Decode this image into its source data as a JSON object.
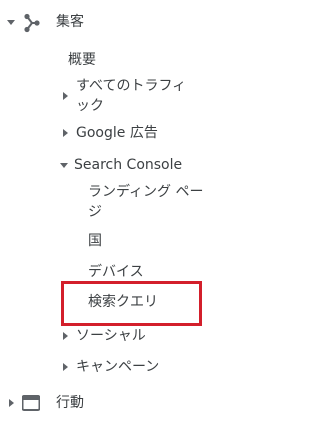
{
  "nav": {
    "section": {
      "label": "集客",
      "icon": "acquisition-icon"
    },
    "items": {
      "overview": "概要",
      "all_traffic_line1": "すべてのトラフィ",
      "all_traffic_line2": "ック",
      "google_ads": "Google 広告",
      "search_console": "Search Console",
      "landing_pages_line1": "ランディング ペー",
      "landing_pages_line2": "ジ",
      "country": "国",
      "devices": "デバイス",
      "queries": "検索クエリ",
      "social": "ソーシャル",
      "campaigns": "キャンペーン"
    },
    "behavior": {
      "label": "行動",
      "icon": "behavior-icon"
    }
  },
  "highlight_color": "#d31f2b"
}
